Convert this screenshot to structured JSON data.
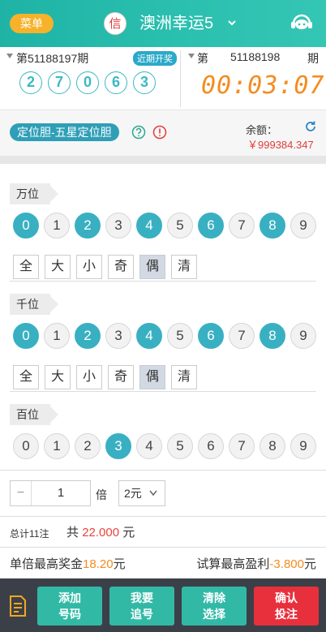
{
  "header": {
    "menu_label": "菜单",
    "xin_label": "信",
    "title": "澳洲幸运5"
  },
  "previous_draw": {
    "issue_label": "第51188197期",
    "recent_label": "近期开奖",
    "numbers": [
      "2",
      "7",
      "0",
      "6",
      "3"
    ]
  },
  "current_draw": {
    "prefix": "第",
    "issue": "51188198",
    "suffix": "期",
    "countdown": "00:03:07"
  },
  "play": {
    "type_label": "定位胆-五星定位胆",
    "balance_label": "余额：",
    "balance_value": "￥999384.347"
  },
  "sections": [
    {
      "label": "万位",
      "numbers": [
        "0",
        "1",
        "2",
        "3",
        "4",
        "5",
        "6",
        "7",
        "8",
        "9"
      ],
      "selected": [
        true,
        false,
        true,
        false,
        true,
        false,
        true,
        false,
        true,
        false
      ],
      "quick": [
        "全",
        "大",
        "小",
        "奇",
        "偶",
        "清"
      ],
      "quick_active": [
        false,
        false,
        false,
        false,
        true,
        false
      ]
    },
    {
      "label": "千位",
      "numbers": [
        "0",
        "1",
        "2",
        "3",
        "4",
        "5",
        "6",
        "7",
        "8",
        "9"
      ],
      "selected": [
        true,
        false,
        true,
        false,
        true,
        false,
        true,
        false,
        true,
        false
      ],
      "quick": [
        "全",
        "大",
        "小",
        "奇",
        "偶",
        "清"
      ],
      "quick_active": [
        false,
        false,
        false,
        false,
        true,
        false
      ]
    },
    {
      "label": "百位",
      "numbers": [
        "0",
        "1",
        "2",
        "3",
        "4",
        "5",
        "6",
        "7",
        "8",
        "9"
      ],
      "selected": [
        false,
        false,
        false,
        true,
        false,
        false,
        false,
        false,
        false,
        false
      ]
    }
  ],
  "bet": {
    "minus": "−",
    "multiplier": "1",
    "bei_label": "倍",
    "unit": "2元"
  },
  "summary": {
    "count_label": "总计11注",
    "gong": "共",
    "amount": "22.000",
    "yuan": "元"
  },
  "prize": {
    "max_prize_label": "单倍最高奖金",
    "max_prize_value": "18.20",
    "max_prize_unit": "元",
    "profit_label": "试算最高盈利",
    "profit_value": "-3.800",
    "profit_unit": "元"
  },
  "actions": {
    "add_line1": "添加",
    "add_line2": "号码",
    "chase_line1": "我要",
    "chase_line2": "追号",
    "clear_line1": "清除",
    "clear_line2": "选择",
    "confirm_line1": "确认",
    "confirm_line2": "投注"
  },
  "colors": {
    "header_teal": "#2cc0b0",
    "ball_selected": "#39b0c2",
    "accent_orange": "#f58b1f",
    "accent_red": "#e8443c"
  }
}
